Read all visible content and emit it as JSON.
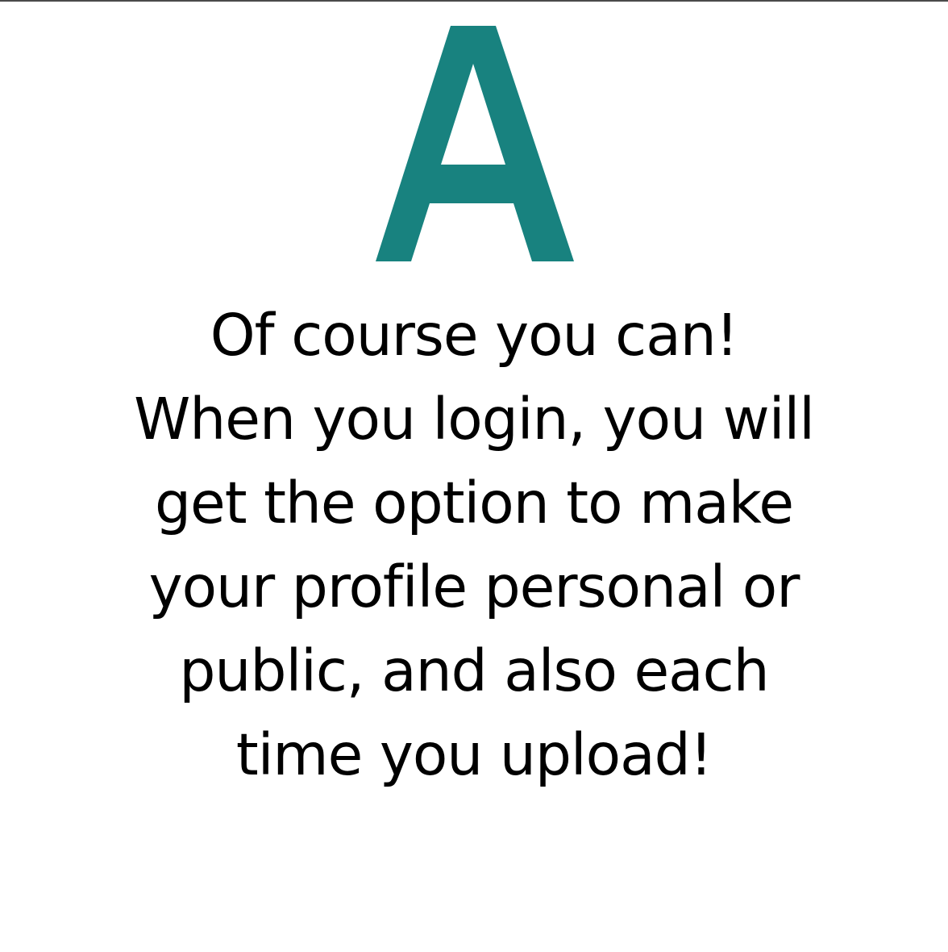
{
  "letter": {
    "text": "A",
    "color": "#18827F"
  },
  "answer": {
    "lines": [
      "Of course you can!",
      "When you login, you will",
      "get the option to make",
      "your profile personal or",
      "public, and also each",
      "time you upload!"
    ],
    "color": "#000000"
  }
}
